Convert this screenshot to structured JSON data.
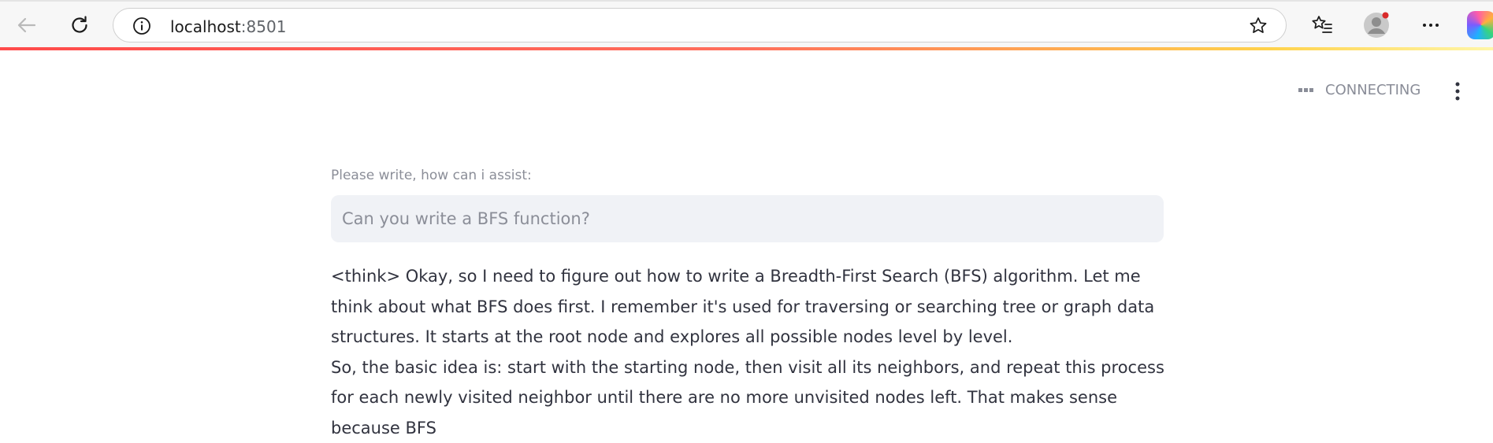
{
  "browser": {
    "url_host": "localhost",
    "url_port": ":8501"
  },
  "app": {
    "status_text": "CONNECTING",
    "input_label": "Please write, how can i assist:",
    "input_placeholder": "Can you write a BFS function?",
    "response_paragraphs": [
      "<think> Okay, so I need to figure out how to write a Breadth-First Search (BFS) algorithm. Let me think about what BFS does first. I remember it's used for traversing or searching tree or graph data structures. It starts at the root node and explores all possible nodes level by level.",
      "So, the basic idea is: start with the starting node, then visit all its neighbors, and repeat this process for each newly visited neighbor until there are no more unvisited nodes left. That makes sense because BFS"
    ]
  },
  "colors": {
    "accent_gradient_start": "#ff4b4b",
    "accent_gradient_end": "#fff6a8",
    "input_bg": "#f0f2f6",
    "text": "#31333f"
  }
}
